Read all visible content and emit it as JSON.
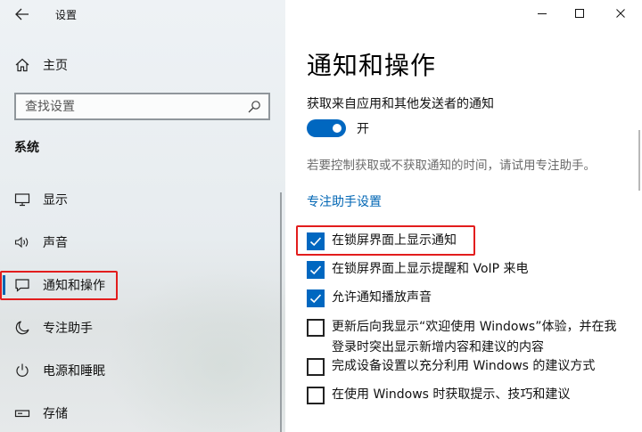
{
  "window": {
    "title": "设置",
    "controls": [
      "minimize-icon",
      "maximize-icon",
      "close-icon"
    ]
  },
  "sidebar": {
    "home": {
      "label": "主页",
      "icon": "home-icon"
    },
    "search": {
      "placeholder": "查找设置",
      "icon": "search-icon"
    },
    "section_title": "系统",
    "items": [
      {
        "label": "显示",
        "icon": "monitor-icon",
        "active": false
      },
      {
        "label": "声音",
        "icon": "speaker-icon",
        "active": false
      },
      {
        "label": "通知和操作",
        "icon": "notification-icon",
        "active": true
      },
      {
        "label": "专注助手",
        "icon": "moon-icon",
        "active": false
      },
      {
        "label": "电源和睡眠",
        "icon": "power-icon",
        "active": false
      },
      {
        "label": "存储",
        "icon": "storage-icon",
        "active": false
      }
    ]
  },
  "main": {
    "title": "通知和操作",
    "subhead": "获取来自应用和其他发送者的通知",
    "toggle": {
      "state": "开",
      "on": true
    },
    "help_text": "若要控制获取或不获取通知的时间，请试用专注助手。",
    "link": "专注助手设置",
    "checkboxes": [
      {
        "label": "在锁屏界面上显示通知",
        "checked": true
      },
      {
        "label": "在锁屏界面上显示提醒和 VoIP 来电",
        "checked": true
      },
      {
        "label": "允许通知播放声音",
        "checked": true
      },
      {
        "label": "更新后向我显示“欢迎使用 Windows”体验，并在我登录时突出显示新增内容和建议的内容",
        "checked": false
      },
      {
        "label": "完成设备设置以充分利用 Windows 的建议方式",
        "checked": false
      },
      {
        "label": "在使用 Windows 时获取提示、技巧和建议",
        "checked": false
      }
    ]
  },
  "colors": {
    "accent": "#0067c0",
    "highlight_box": "#e21d1d",
    "link": "#0066b4"
  }
}
